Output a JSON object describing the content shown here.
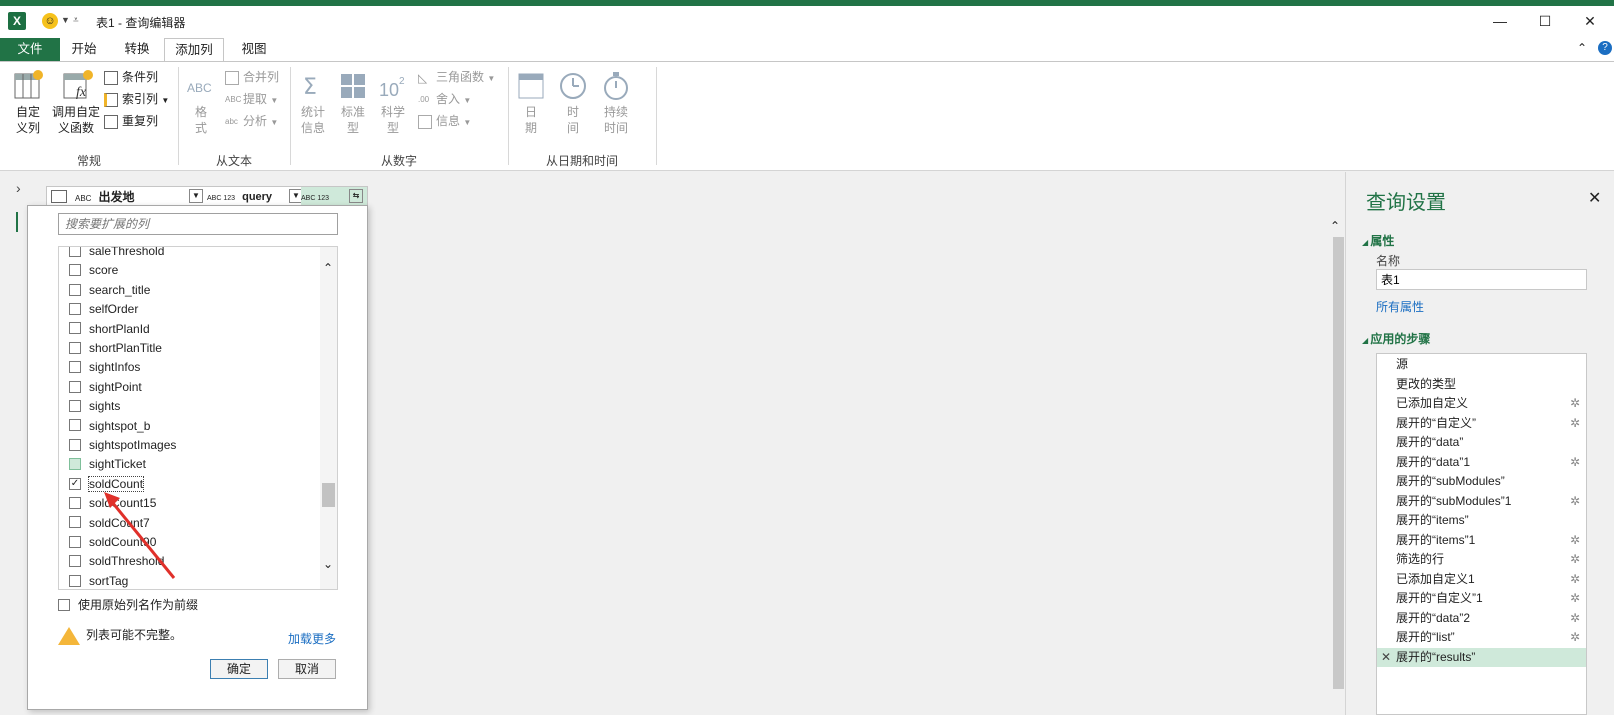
{
  "window": {
    "title": "表1 - 查询编辑器",
    "app_logo_text": "X",
    "minimize": "—",
    "maximize": "☐",
    "close": "✕"
  },
  "ribbon_tabs": [
    "文件",
    "开始",
    "转换",
    "添加列",
    "视图"
  ],
  "ribbon": {
    "groups": {
      "general": "常规",
      "from_text": "从文本",
      "from_number": "从数字",
      "from_datetime": "从日期和时间"
    },
    "custom_column": [
      "自定",
      "义列"
    ],
    "invoke_function": [
      "调用自定",
      "义函数"
    ],
    "conditional_column": "条件列",
    "index_column": "索引列",
    "duplicate_column": "重复列",
    "format": [
      "格",
      "式"
    ],
    "merge_columns": "合并列",
    "extract": "提取",
    "parse": "分析",
    "statistics": [
      "统计",
      "信息"
    ],
    "standard": [
      "标准",
      "型"
    ],
    "scientific": [
      "科学",
      "型"
    ],
    "trigonometry": "三角函数",
    "rounding": "舍入",
    "information": "信息",
    "date": [
      "日",
      "期"
    ],
    "time": [
      "时",
      "间"
    ],
    "duration": [
      "持续",
      "时间"
    ]
  },
  "columns": [
    {
      "type": "ABC",
      "name": "出发地"
    },
    {
      "type": "ABC 123",
      "name": "query"
    },
    {
      "type": "ABC 123",
      "name": "results"
    }
  ],
  "expand_popup": {
    "search_placeholder": "搜索要扩展的列",
    "items": [
      {
        "label": "saleThreshold",
        "checked": false
      },
      {
        "label": "score",
        "checked": false
      },
      {
        "label": "search_title",
        "checked": false
      },
      {
        "label": "selfOrder",
        "checked": false
      },
      {
        "label": "shortPlanId",
        "checked": false
      },
      {
        "label": "shortPlanTitle",
        "checked": false
      },
      {
        "label": "sightInfos",
        "checked": false
      },
      {
        "label": "sightPoint",
        "checked": false
      },
      {
        "label": "sights",
        "checked": false
      },
      {
        "label": "sightspot_b",
        "checked": false
      },
      {
        "label": "sightspotImages",
        "checked": false
      },
      {
        "label": "sightTicket",
        "checked": false
      },
      {
        "label": "soldCount",
        "checked": true
      },
      {
        "label": "soldCount15",
        "checked": false
      },
      {
        "label": "soldCount7",
        "checked": false
      },
      {
        "label": "soldCount90",
        "checked": false
      },
      {
        "label": "soldThreshold",
        "checked": false
      },
      {
        "label": "sortTag",
        "checked": false
      }
    ],
    "use_prefix_label": "使用原始列名作为前缀",
    "warning": "列表可能不完整。",
    "load_more": "加载更多",
    "ok": "确定",
    "cancel": "取消"
  },
  "query_settings": {
    "title": "查询设置",
    "properties_header": "属性",
    "name_label": "名称",
    "name_value": "表1",
    "all_properties": "所有属性",
    "applied_steps_header": "应用的步骤",
    "steps": [
      {
        "label": "源",
        "gear": false
      },
      {
        "label": "更改的类型",
        "gear": false
      },
      {
        "label": "已添加自定义",
        "gear": true
      },
      {
        "label": "展开的“自定义”",
        "gear": true
      },
      {
        "label": "展开的“data”",
        "gear": false
      },
      {
        "label": "展开的“data”1",
        "gear": true
      },
      {
        "label": "展开的“subModules”",
        "gear": false
      },
      {
        "label": "展开的“subModules”1",
        "gear": true
      },
      {
        "label": "展开的“items”",
        "gear": false
      },
      {
        "label": "展开的“items”1",
        "gear": true
      },
      {
        "label": "筛选的行",
        "gear": true
      },
      {
        "label": "已添加自定义1",
        "gear": true
      },
      {
        "label": "展开的“自定义”1",
        "gear": true
      },
      {
        "label": "展开的“data”2",
        "gear": true
      },
      {
        "label": "展开的“list”",
        "gear": true
      },
      {
        "label": "展开的“results”",
        "gear": false,
        "active": true
      }
    ]
  },
  "colors": {
    "accent": "#217346",
    "selected_step": "#cfe9da",
    "annotation_arrow": "#e0302a"
  }
}
